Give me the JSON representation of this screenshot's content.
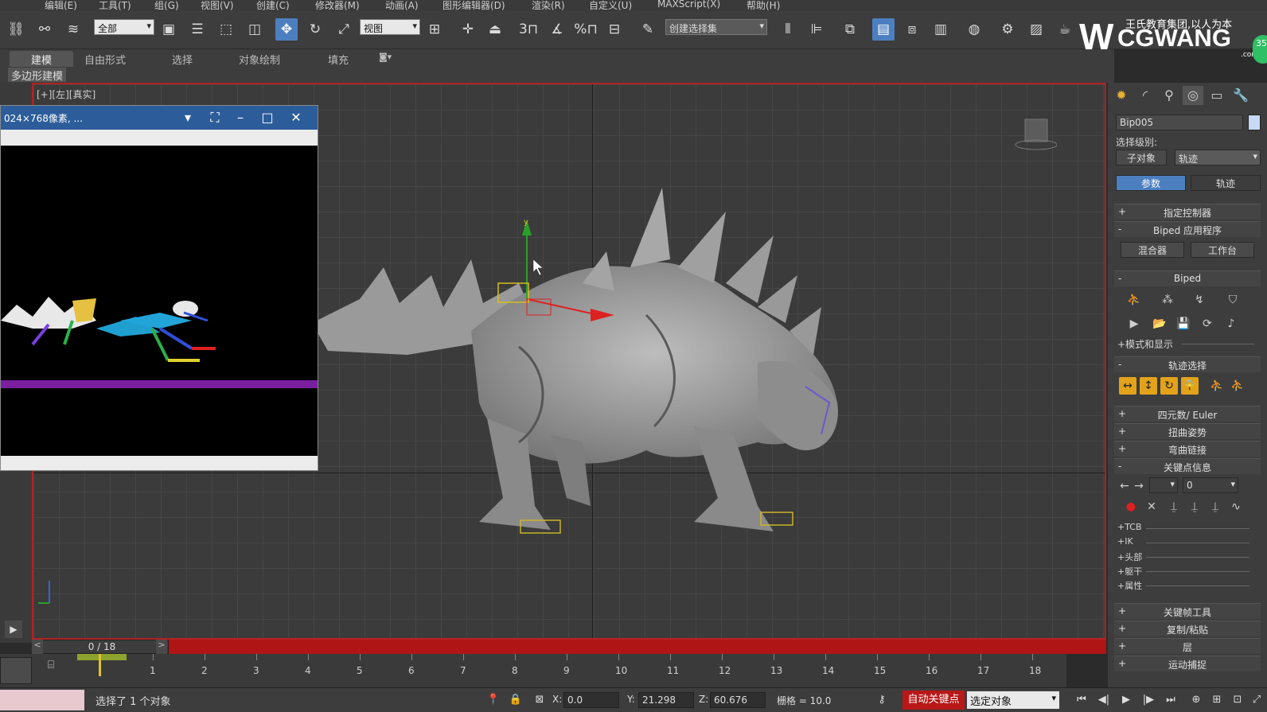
{
  "menubar": {
    "items": [
      "编辑(E)",
      "工具(T)",
      "组(G)",
      "视图(V)",
      "创建(C)",
      "修改器(M)",
      "动画(A)",
      "图形编辑器(D)",
      "渲染(R)",
      "自定义(U)",
      "MAXScript(X)",
      "帮助(H)"
    ]
  },
  "toolbar": {
    "filter_dropdown": "全部",
    "ref_coord_dropdown": "视图",
    "named_sel_dropdown": "创建选择集",
    "snap_labels": [
      "3",
      "%"
    ]
  },
  "logo": {
    "top_text": "王氏教育集团,以人为本",
    "main_text": "CGWANG",
    "suffix": ".com",
    "badge": "35"
  },
  "ribbon": {
    "tabs": [
      "建模",
      "自由形式",
      "选择",
      "对象绘制",
      "填充"
    ],
    "sub_label": "多边形建模"
  },
  "viewport": {
    "label": "[+][左][真实]"
  },
  "float_window": {
    "title": "024×768像素, ..."
  },
  "command_panel": {
    "object_name": "Bip005",
    "sel_level_label": "选择级别:",
    "sub_object_btn": "子对象",
    "sel_level_dropdown": "轨迹",
    "tab_params": "参数",
    "tab_tracks": "轨迹",
    "rollouts": {
      "assign_controller": "指定控制器",
      "biped_apps": "Biped 应用程序",
      "mixer": "混合器",
      "workbench": "工作台",
      "biped": "Biped",
      "mode_display": "+模式和显示",
      "track_selection": "轨迹选择",
      "quaternion_euler": "四元数/ Euler",
      "twist_poses": "扭曲姿势",
      "bend_links": "弯曲链接",
      "key_info": "关键点信息",
      "key_frame_tools": "关键帧工具",
      "copy_paste": "复制/粘贴",
      "layers": "层",
      "motion_capture": "运动捕捉"
    },
    "key_info_field": "0",
    "sub_rollouts": [
      "+TCB",
      "+IK",
      "+头部",
      "+躯干",
      "+属性"
    ]
  },
  "timeslider": {
    "value": "0 / 18",
    "prev": "<",
    "next": ">"
  },
  "trackbar": {
    "ticks": [
      "1",
      "2",
      "3",
      "4",
      "5",
      "6",
      "7",
      "8",
      "9",
      "10",
      "11",
      "12",
      "13",
      "14",
      "15",
      "16",
      "17",
      "18"
    ]
  },
  "statusbar": {
    "message": "选择了 1 个对象",
    "x_label": "X:",
    "x_value": "0.0",
    "y_label": "Y:",
    "y_value": "21.298",
    "z_label": "Z:",
    "z_value": "60.676",
    "grid": "栅格 = 10.0",
    "autokey": "自动关键点",
    "selected_dropdown": "选定对象"
  },
  "colors": {
    "accent": "#4c7fc0",
    "autokey_red": "#b81818",
    "timeslider_red": "#b01515",
    "title_blue": "#2c5d9a"
  }
}
